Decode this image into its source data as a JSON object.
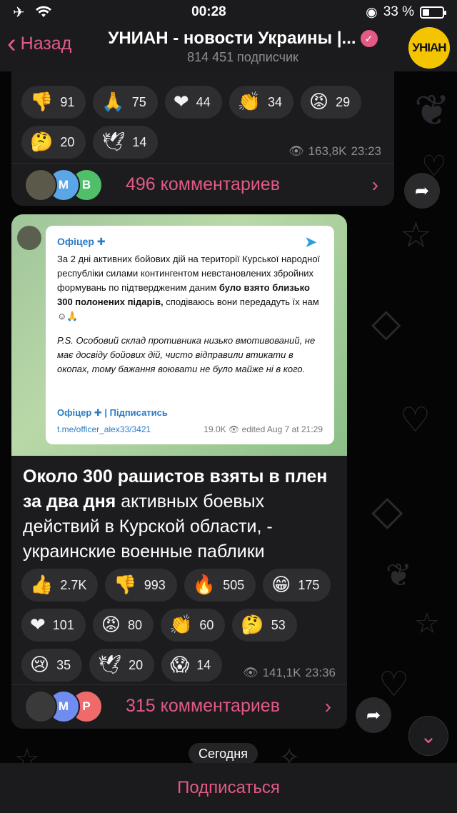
{
  "status_bar": {
    "time": "00:28",
    "battery": "33 %",
    "battery_level": 0.33
  },
  "header": {
    "back_label": "Назад",
    "title": "УНИАН - новости Украины |...",
    "subscribers": "814 451 подписчик",
    "avatar_text": "УНІАН"
  },
  "post1": {
    "reactions": [
      {
        "emoji": "👎",
        "icon": "thumbs-down",
        "count": "91"
      },
      {
        "emoji": "🙏",
        "icon": "pray",
        "count": "75"
      },
      {
        "emoji": "❤",
        "icon": "heart",
        "count": "44"
      },
      {
        "emoji": "👏",
        "icon": "clap",
        "count": "34"
      },
      {
        "emoji": "😡",
        "icon": "angry",
        "count": "29"
      },
      {
        "emoji": "🤔",
        "icon": "thinking",
        "count": "20"
      },
      {
        "emoji": "🕊",
        "icon": "dove",
        "count": "14"
      }
    ],
    "views": "163,8K",
    "time": "23:23",
    "comment_avatars": [
      "",
      "M",
      "B"
    ],
    "comments": "496 комментариев"
  },
  "post2": {
    "embed": {
      "author": "Офіцер ✚",
      "text_1": "За 2 дні активних бойових дій на території Курської народної республіки силами контингентом невстановлених збройних формувань по підтвердженим даним",
      "text_1_bold": "було взято близько 300 полонених підарів,",
      "text_1_end": "сподіваюсь вони передадуть їх нам ☺🙏",
      "text_2": "P.S. Особовий склад противника низько вмотивований, не має досвіду бойових дій, чисто відправили втикати в окопах, тому бажання воювати не було майже ні в кого.",
      "subscribe": "Офіцер ✚ | Підписатись",
      "link": "t.me/officer_alex33/3421",
      "views": "19.0K",
      "edited": "edited  Aug 7 at 21:29"
    },
    "headline_bold": "Около 300 рашистов взяты в плен за два дня",
    "headline_rest": " активных боевых действий в Курской области, - украинские военные паблики",
    "reactions": [
      {
        "emoji": "👍",
        "icon": "thumbs-up",
        "count": "2.7K"
      },
      {
        "emoji": "👎",
        "icon": "thumbs-down",
        "count": "993"
      },
      {
        "emoji": "🔥",
        "icon": "fire",
        "count": "505"
      },
      {
        "emoji": "😁",
        "icon": "grin",
        "count": "175"
      },
      {
        "emoji": "❤",
        "icon": "heart",
        "count": "101"
      },
      {
        "emoji": "😡",
        "icon": "angry",
        "count": "80"
      },
      {
        "emoji": "👏",
        "icon": "clap",
        "count": "60"
      },
      {
        "emoji": "🤔",
        "icon": "thinking",
        "count": "53"
      },
      {
        "emoji": "😢",
        "icon": "cry",
        "count": "35"
      },
      {
        "emoji": "🕊",
        "icon": "dove",
        "count": "20"
      },
      {
        "emoji": "😱",
        "icon": "scream",
        "count": "14"
      }
    ],
    "views": "141,1K",
    "time": "23:36",
    "comment_avatars": [
      "",
      "M",
      "P"
    ],
    "comments": "315 комментариев"
  },
  "date_separator": "Сегодня",
  "subscribe_button": "Подписаться",
  "colors": {
    "accent": "#e35a86",
    "bubble": "#1c1c1e",
    "unian": "#f5c400"
  }
}
